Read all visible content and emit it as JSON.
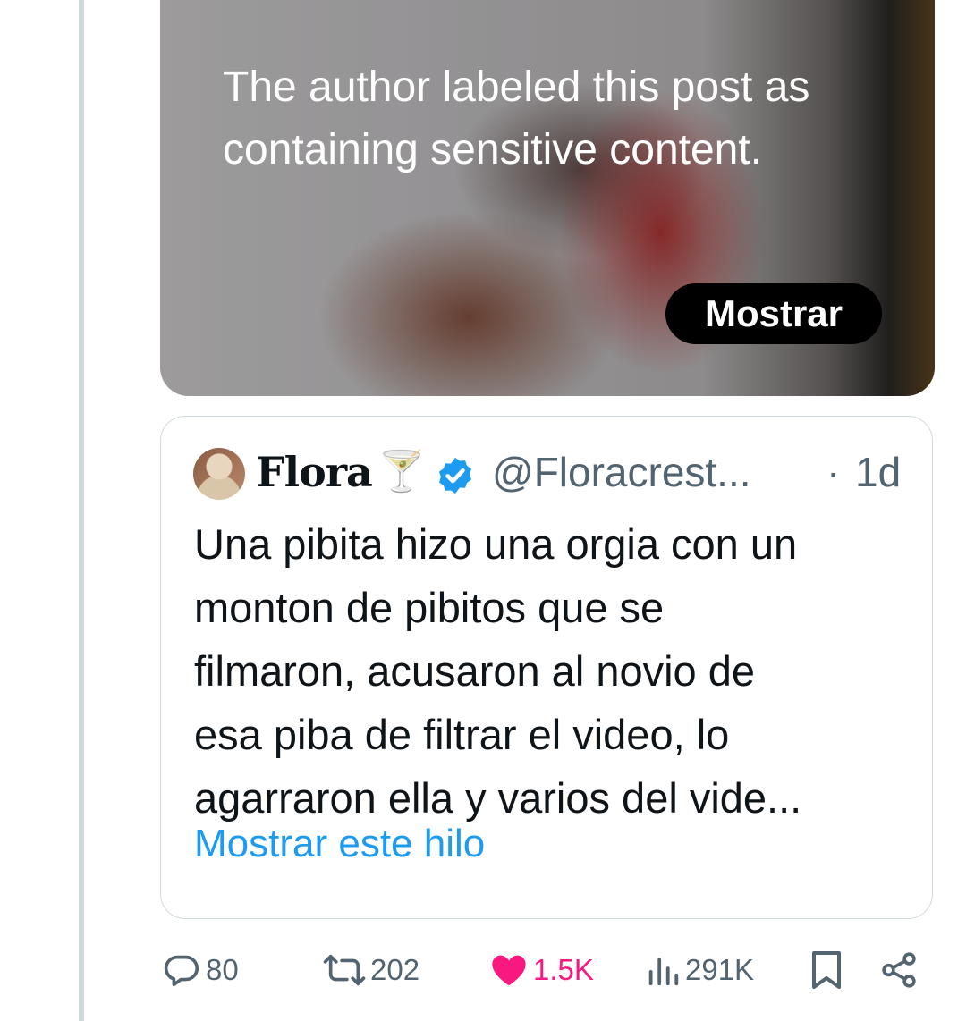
{
  "media": {
    "sensitive_notice": "The author labeled this post as containing sensitive content.",
    "show_label": "Mostrar"
  },
  "quote": {
    "display_name": "Flora",
    "display_name_emoji": "🍸",
    "verified": true,
    "handle": "@Floracrest...",
    "dot": "·",
    "time": "1d",
    "text": "Una pibita hizo una orgia con un\nmonton de pibitos que se\nfilmaron, acusaron al novio de\nesa piba de filtrar el video, lo\nagarraron ella y varios del vide...",
    "thread_link": "Mostrar este hilo"
  },
  "actions": {
    "replies": "80",
    "reposts": "202",
    "likes": "1.5K",
    "views": "291K",
    "icons": [
      "reply-icon",
      "repost-icon",
      "heart-icon",
      "views-icon",
      "bookmark-icon",
      "share-icon"
    ]
  },
  "colors": {
    "accent": "#1d9bf0",
    "like": "#f91880",
    "muted": "#536471",
    "thread_line": "#cfd9de"
  }
}
